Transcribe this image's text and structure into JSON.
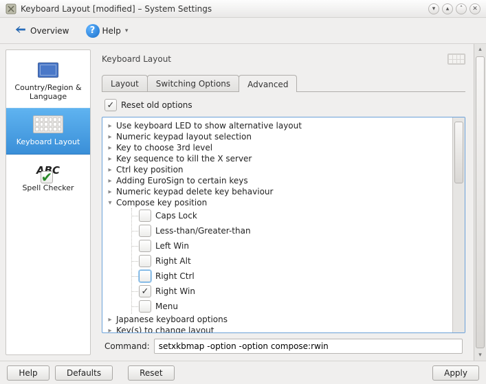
{
  "window": {
    "title": "Keyboard Layout [modified] – System Settings"
  },
  "toolbar": {
    "overview": "Overview",
    "help": "Help"
  },
  "sidebar": {
    "items": [
      {
        "label": "Country/Region & Language"
      },
      {
        "label": "Keyboard Layout"
      },
      {
        "label": "Spell Checker"
      }
    ]
  },
  "pane": {
    "title": "Keyboard Layout"
  },
  "tabs": {
    "items": [
      {
        "label": "Layout"
      },
      {
        "label": "Switching Options"
      },
      {
        "label": "Advanced"
      }
    ],
    "active": 2
  },
  "advanced": {
    "reset_old_options": {
      "label": "Reset old options",
      "checked": true
    },
    "tree": [
      {
        "label": "Use keyboard LED to show alternative layout",
        "expanded": false
      },
      {
        "label": "Numeric keypad layout selection",
        "expanded": false
      },
      {
        "label": "Key to choose 3rd level",
        "expanded": false
      },
      {
        "label": "Key sequence to kill the X server",
        "expanded": false
      },
      {
        "label": "Ctrl key position",
        "expanded": false
      },
      {
        "label": "Adding EuroSign to certain keys",
        "expanded": false
      },
      {
        "label": "Numeric keypad delete key behaviour",
        "expanded": false
      },
      {
        "label": "Compose key position",
        "expanded": true,
        "children": [
          {
            "label": "Caps Lock",
            "checked": false
          },
          {
            "label": "Less-than/Greater-than",
            "checked": false
          },
          {
            "label": "Left Win",
            "checked": false
          },
          {
            "label": "Right Alt",
            "checked": false
          },
          {
            "label": "Right Ctrl",
            "checked": false,
            "highlighted": true
          },
          {
            "label": "Right Win",
            "checked": true
          },
          {
            "label": "Menu",
            "checked": false
          }
        ]
      },
      {
        "label": "Japanese keyboard options",
        "expanded": false
      },
      {
        "label": "Key(s) to change layout",
        "expanded": false
      }
    ]
  },
  "command": {
    "label": "Command:",
    "value": "setxkbmap -option -option compose:rwin"
  },
  "buttons": {
    "help": "Help",
    "defaults": "Defaults",
    "reset": "Reset",
    "apply": "Apply"
  }
}
